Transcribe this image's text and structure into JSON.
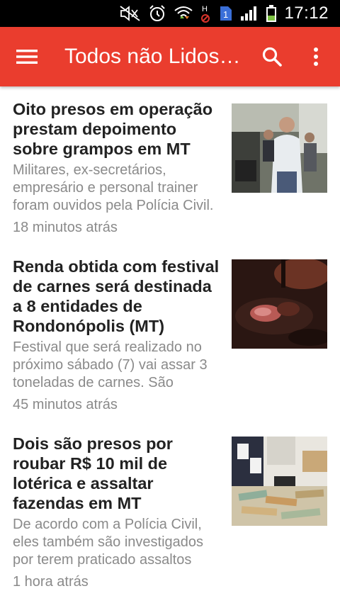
{
  "status_bar": {
    "time": "17:12",
    "icons": [
      "mute-icon",
      "alarm-icon",
      "wifi-icon",
      "h-network-icon",
      "sim-1-icon",
      "signal-icon",
      "battery-icon"
    ],
    "sim_label": "1"
  },
  "app_bar": {
    "title": "Todos não Lidos…",
    "color": "#ea3d2e",
    "icons": [
      "menu-icon",
      "search-icon",
      "more-vert-icon"
    ]
  },
  "articles": [
    {
      "title": "Oito presos em operação prestam depoimento sobre grampos em MT",
      "summary": "Militares, ex-secretários, empresário e personal trainer foram ouvidos pela Polícia Civil.",
      "time": "18 minutos atrás"
    },
    {
      "title": "Renda obtida com festival de carnes será destinada a 8 entidades de Rondonópolis (MT)",
      "summary": "Festival que será realizado no próximo sábado (7) vai assar 3 toneladas de carnes. São",
      "time": "45 minutos atrás"
    },
    {
      "title": "Dois são presos por roubar R$ 10 mil de lotérica e assaltar fazendas em MT",
      "summary": "De acordo com a Polícia Civil, eles também são investigados por terem praticado assaltos",
      "time": "1 hora atrás"
    }
  ]
}
